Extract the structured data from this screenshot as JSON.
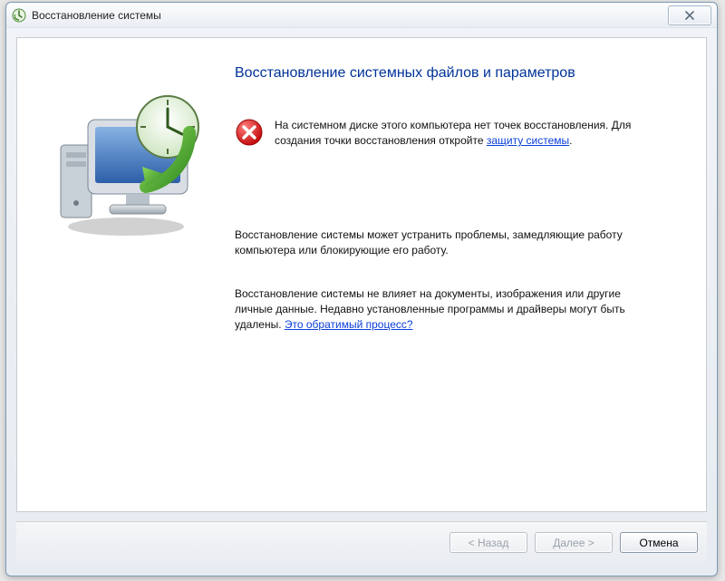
{
  "window": {
    "title": "Восстановление системы"
  },
  "header": {
    "title": "Восстановление системных файлов и параметров"
  },
  "error": {
    "line1": "На системном диске этого компьютера нет точек восстановления. Для создания точки восстановления откройте ",
    "link": "защиту системы",
    "tail": "."
  },
  "p1": "Восстановление системы может устранить проблемы, замедляющие работу компьютера или блокирующие его работу.",
  "p2": {
    "text": "Восстановление системы не влияет на документы, изображения или другие личные данные. Недавно установленные программы и драйверы могут быть удалены. ",
    "link": "Это обратимый процесс?"
  },
  "buttons": {
    "back": "< Назад",
    "next": "Далее >",
    "cancel": "Отмена"
  }
}
